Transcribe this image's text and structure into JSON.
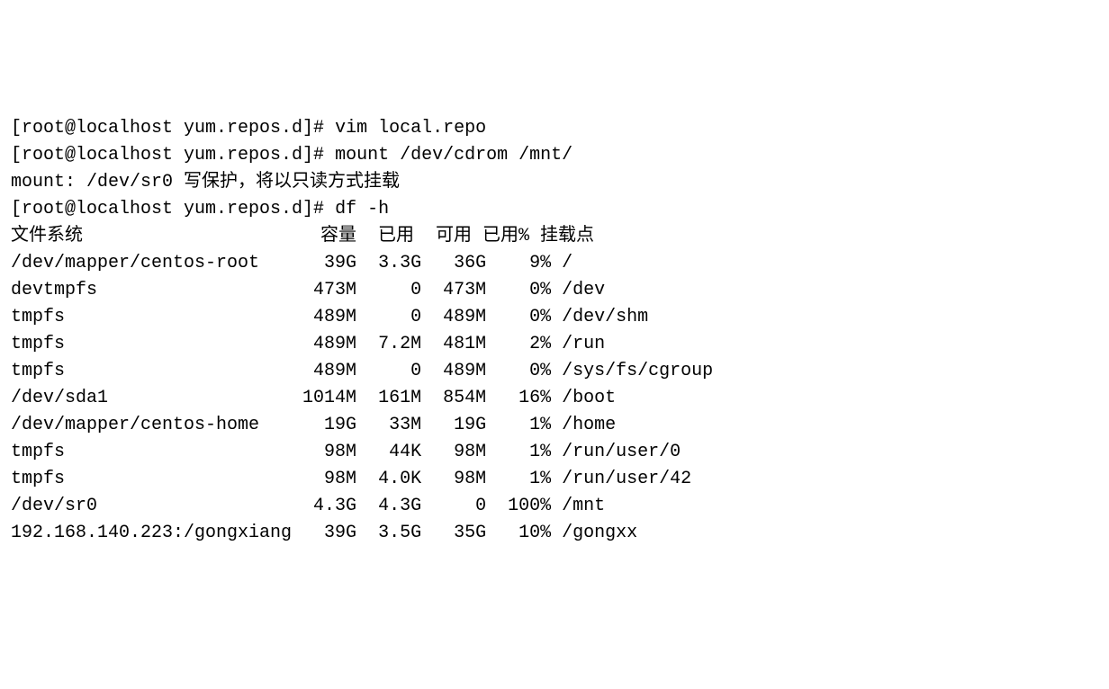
{
  "prompt1": "[root@localhost yum.repos.d]# ",
  "cmd1": "vim local.repo",
  "prompt2": "[root@localhost yum.repos.d]# ",
  "cmd2": "mount /dev/cdrom /mnt/",
  "mount_msg": "mount: /dev/sr0 写保护，将以只读方式挂载",
  "prompt3": "[root@localhost yum.repos.d]# ",
  "cmd3": "df -h",
  "df_header": "文件系统                      容量  已用  可用 已用% 挂载点",
  "df_rows": [
    "/dev/mapper/centos-root      39G  3.3G   36G    9% /",
    "devtmpfs                    473M     0  473M    0% /dev",
    "tmpfs                       489M     0  489M    0% /dev/shm",
    "tmpfs                       489M  7.2M  481M    2% /run",
    "tmpfs                       489M     0  489M    0% /sys/fs/cgroup",
    "/dev/sda1                  1014M  161M  854M   16% /boot",
    "/dev/mapper/centos-home      19G   33M   19G    1% /home",
    "tmpfs                        98M   44K   98M    1% /run/user/0",
    "tmpfs                        98M  4.0K   98M    1% /run/user/42",
    "/dev/sr0                    4.3G  4.3G     0  100% /mnt",
    "192.168.140.223:/gongxiang   39G  3.5G   35G   10% /gongxx"
  ]
}
